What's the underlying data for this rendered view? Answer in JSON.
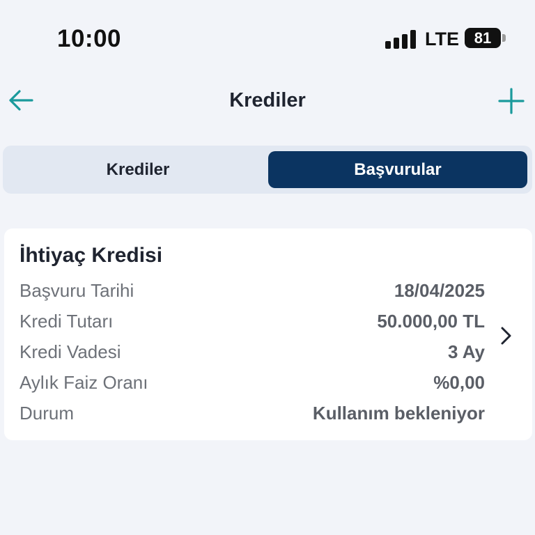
{
  "status_bar": {
    "time": "10:00",
    "network": "LTE",
    "battery": "81"
  },
  "header": {
    "title": "Krediler",
    "back_icon": "arrow-left-icon",
    "add_icon": "plus-icon"
  },
  "tabs": [
    {
      "label": "Krediler",
      "selected": false
    },
    {
      "label": "Başvurular",
      "selected": true
    }
  ],
  "application_card": {
    "title": "İhtiyaç Kredisi",
    "rows": [
      {
        "label": "Başvuru Tarihi",
        "value": "18/04/2025"
      },
      {
        "label": "Kredi Tutarı",
        "value": "50.000,00 TL"
      },
      {
        "label": "Kredi Vadesi",
        "value": "3 Ay"
      },
      {
        "label": "Aylık Faiz Oranı",
        "value": "%0,00"
      },
      {
        "label": "Durum",
        "value": "Kullanım bekleniyor"
      }
    ],
    "chevron_icon": "chevron-right-icon"
  },
  "colors": {
    "accent": "#1a9a9c",
    "active_tab": "#0b3461",
    "background": "#f2f4f9"
  }
}
